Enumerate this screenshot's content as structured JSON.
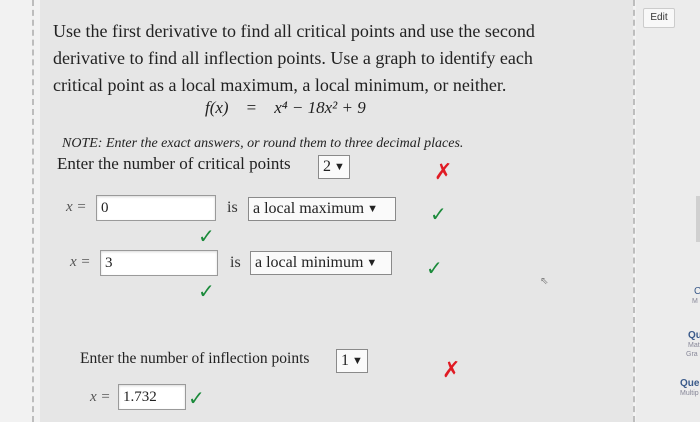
{
  "prompt_text": "Use the first derivative to find all critical points and use the second derivative to find all inflection points. Use a graph to identify each critical point as a local maximum, a local minimum, or neither.",
  "formula": {
    "lhs": "f(x)",
    "eq": "=",
    "rhs": "x⁴ − 18x² + 9"
  },
  "note": "NOTE: Enter the exact answers, or round them to three decimal places.",
  "critical": {
    "label": "Enter the number of critical points",
    "selected": "2"
  },
  "rows": [
    {
      "var": "x =",
      "value": "0",
      "is": "is",
      "classification": "a local maximum"
    },
    {
      "var": "x =",
      "value": "3",
      "is": "is",
      "classification": "a local minimum"
    }
  ],
  "inflection": {
    "label": "Enter the number of inflection points",
    "selected": "1",
    "var": "x =",
    "value": "1.732"
  },
  "marks": {
    "wrong": "✗",
    "right": "✓"
  },
  "side": {
    "edit": "Edit",
    "c": "C",
    "m": "M",
    "qu": "Qu",
    "mat": "Mat",
    "gra": "Gra",
    "que": "Que",
    "multip": "Multip"
  },
  "colors": {
    "wrong": "#e01b24",
    "right": "#1a8a3a"
  }
}
